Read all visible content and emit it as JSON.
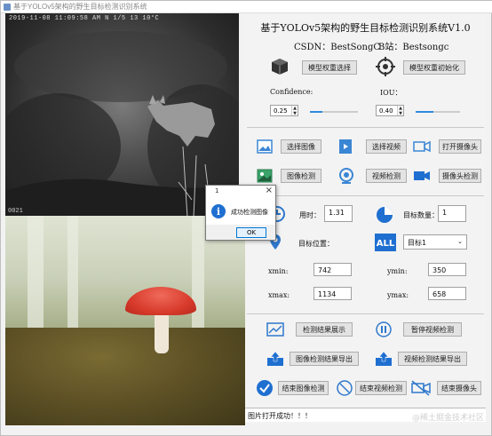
{
  "window": {
    "title": "基于YOLOv5架构的野生目标检测识别系统"
  },
  "camera": {
    "overlay_text": "2019-11-08  11:09:58 AM   N 1/5          13  10°C",
    "bottom_text": "0021"
  },
  "header": {
    "title": "基于YOLOv5架构的野生目标检测识别系统V1.0",
    "csdn": "CSDN：BestSongC",
    "bili": "B站：Bestsongc"
  },
  "model": {
    "select_label": "模型权重选择",
    "init_label": "模型权重初始化",
    "confidence_label": "Confidence:",
    "iou_label": "IOU：",
    "confidence_value": "0.25",
    "iou_value": "0.40",
    "confidence_level": 0.25,
    "iou_level": 0.4
  },
  "actions": {
    "select_image": "选择图像",
    "select_video": "选择视频",
    "open_camera": "打开摄像头",
    "image_detect": "图像检测",
    "video_detect": "视频检测",
    "camera_detect": "摄像头检测"
  },
  "results": {
    "time_label": "用时：",
    "time_value": "1.31",
    "count_label": "目标数量：",
    "count_value": "1",
    "position_label": "目标位置：",
    "target_select": "目标1",
    "xmin_label": "xmin:",
    "xmin_value": "742",
    "ymin_label": "ymin:",
    "ymin_value": "350",
    "xmax_label": "xmax:",
    "xmax_value": "1134",
    "ymax_label": "ymax:",
    "ymax_value": "658"
  },
  "controls": {
    "show_results": "检测结果展示",
    "pause_video": "暂停视频检测",
    "export_image": "图像检测结果导出",
    "export_video": "视频检测结果导出",
    "end_image": "结束图像检测",
    "end_video": "结束视频检测",
    "end_camera": "结束摄像头"
  },
  "status": {
    "text": "图片打开成功！！！"
  },
  "dialog": {
    "title": "1",
    "message": "成功检测图像",
    "ok": "OK"
  },
  "watermark": "@稀土掘金技术社区",
  "colors": {
    "accent": "#2f8ae0",
    "dialog_info": "#1f6fd1",
    "button_bg": "#e3e3e3"
  }
}
